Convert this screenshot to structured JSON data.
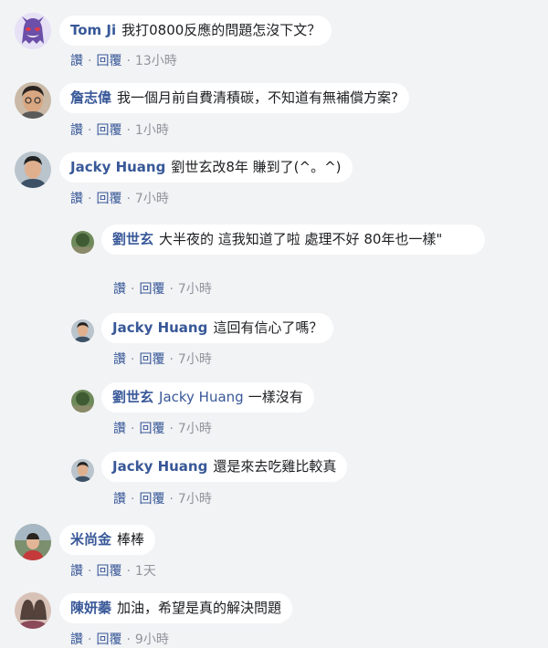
{
  "comments": [
    {
      "author": "Tom Ji",
      "mention": "",
      "text": "我打0800反應的問題怎沒下文？",
      "like": "讚",
      "reply": "回覆",
      "time": "13小時"
    },
    {
      "author": "詹志偉",
      "mention": "",
      "text": "我一個月前自費清積碳，不知道有無補償方案?",
      "like": "讚",
      "reply": "回覆",
      "time": "1小時"
    },
    {
      "author": "Jacky Huang",
      "mention": "",
      "text": "劉世玄改8年  賺到了(^。^)",
      "like": "讚",
      "reply": "回覆",
      "time": "7小時"
    },
    {
      "author": "劉世玄",
      "mention": "",
      "text": "大半夜的 這我知道了啦 處理不好 80年也一樣\"",
      "like": "讚",
      "reply": "回覆",
      "time": "7小時"
    },
    {
      "author": "Jacky Huang",
      "mention": "",
      "text": "這回有信心了嗎？",
      "like": "讚",
      "reply": "回覆",
      "time": "7小時"
    },
    {
      "author": "劉世玄",
      "mention": "Jacky Huang",
      "text": "一樣沒有",
      "like": "讚",
      "reply": "回覆",
      "time": "7小時"
    },
    {
      "author": "Jacky Huang",
      "mention": "",
      "text": "還是來去吃雞比較真",
      "like": "讚",
      "reply": "回覆",
      "time": "7小時"
    },
    {
      "author": "米尚金",
      "mention": "",
      "text": "棒棒",
      "like": "讚",
      "reply": "回覆",
      "time": "1天"
    },
    {
      "author": "陳妍蓁",
      "mention": "",
      "text": "加油，希望是真的解決問題",
      "like": "讚",
      "reply": "回覆",
      "time": "9小時"
    }
  ],
  "colors": {
    "link": "#385898",
    "meta": "#90949c",
    "bubble": "#ffffff",
    "background": "#f2f3f5"
  }
}
